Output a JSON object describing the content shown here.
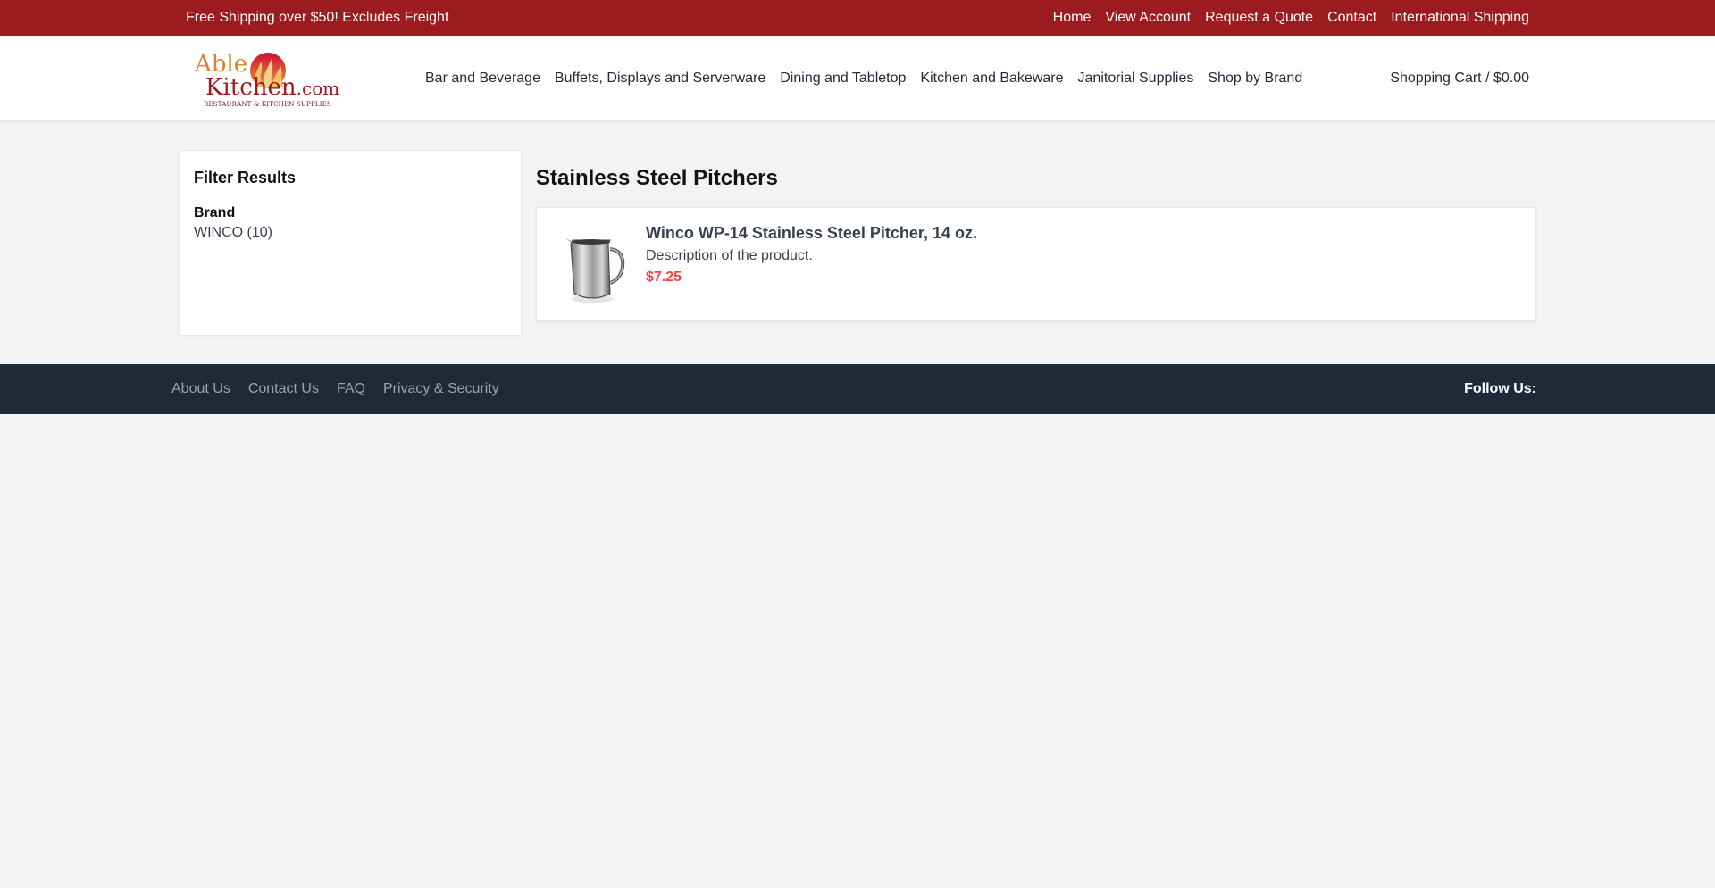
{
  "topbar": {
    "promo": "Free Shipping over $50! Excludes Freight",
    "links": [
      "Home",
      "View Account",
      "Request a Quote",
      "Contact",
      "International Shipping"
    ]
  },
  "header": {
    "logo": {
      "able": "Able",
      "kitchen": "Kitchen",
      "com": ".com",
      "tagline": "RESTAURANT & KITCHEN SUPPLIES"
    },
    "nav": [
      "Bar and Beverage",
      "Buffets, Displays and Serverware",
      "Dining and Tabletop",
      "Kitchen and Bakeware",
      "Janitorial Supplies",
      "Shop by Brand"
    ],
    "cart": "Shopping Cart / $0.00"
  },
  "sidebar": {
    "title": "Filter Results",
    "brand_heading": "Brand",
    "brand_option": "WINCO (10)"
  },
  "main": {
    "title": "Stainless Steel Pitchers",
    "product": {
      "name": "Winco WP-14 Stainless Steel Pitcher, 14 oz.",
      "description": "Description of the product.",
      "price": "$7.25",
      "image": "pitcher-image"
    }
  },
  "footer": {
    "links": [
      "About Us",
      "Contact Us",
      "FAQ",
      "Privacy & Security"
    ],
    "follow": "Follow Us:"
  },
  "colors": {
    "topbar": "#9b1b1f",
    "footer": "#1f2937",
    "price": "#ef4444",
    "page_bg": "#f2f3f5"
  }
}
